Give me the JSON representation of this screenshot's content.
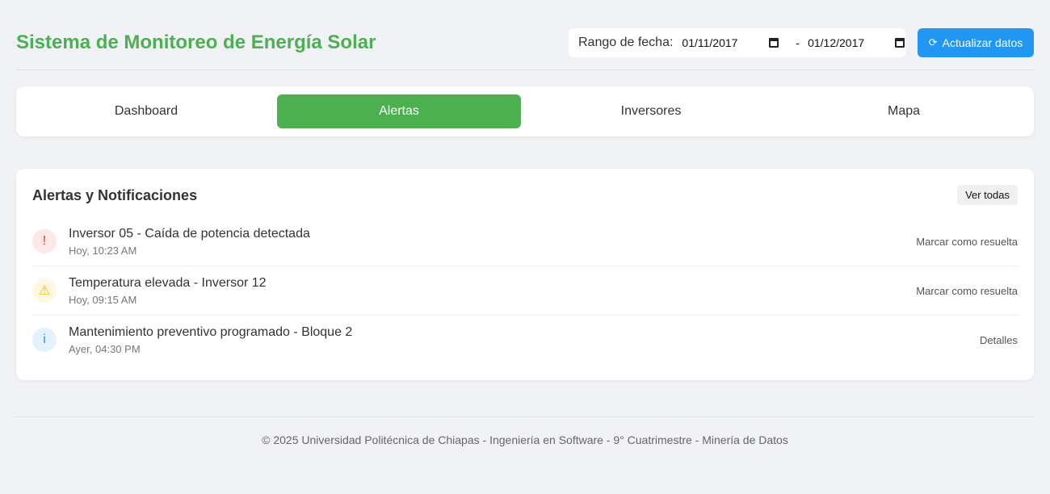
{
  "header": {
    "title": "Sistema de Monitoreo de Energía Solar",
    "date_range_label": "Rango de fecha:",
    "date_from": "01/11/2017",
    "date_to": "01/12/2017",
    "date_separator": "-",
    "refresh_icon": "⟳",
    "refresh_label": "Actualizar datos"
  },
  "tabs": [
    {
      "label": "Dashboard",
      "active": false
    },
    {
      "label": "Alertas",
      "active": true
    },
    {
      "label": "Inversores",
      "active": false
    },
    {
      "label": "Mapa",
      "active": false
    }
  ],
  "alerts_card": {
    "title": "Alertas y Notificaciones",
    "view_all_label": "Ver todas",
    "items": [
      {
        "icon": "!",
        "icon_name": "error-icon",
        "icon_color": "#e53935",
        "icon_bg": "#fde8e8",
        "title": "Inversor 05 - Caída de potencia detectada",
        "time": "Hoy, 10:23 AM",
        "action": "Marcar como resuelta"
      },
      {
        "icon": "⚠",
        "icon_name": "warning-icon",
        "icon_color": "#f5b800",
        "icon_bg": "#fff7e0",
        "title": "Temperatura elevada - Inversor 12",
        "time": "Hoy, 09:15 AM",
        "action": "Marcar como resuelta"
      },
      {
        "icon": "i",
        "icon_name": "info-icon",
        "icon_color": "#2196f3",
        "icon_bg": "#e3f2fd",
        "title": "Mantenimiento preventivo programado - Bloque 2",
        "time": "Ayer, 04:30 PM",
        "action": "Detalles"
      }
    ]
  },
  "footer": {
    "text": "© 2025 Universidad Politécnica de Chiapas - Ingeniería en Software - 9° Cuatrimestre - Minería de Datos"
  },
  "colors": {
    "brand_green": "#4caf50",
    "accent_blue": "#2196f3",
    "background": "#f0f2f5"
  }
}
